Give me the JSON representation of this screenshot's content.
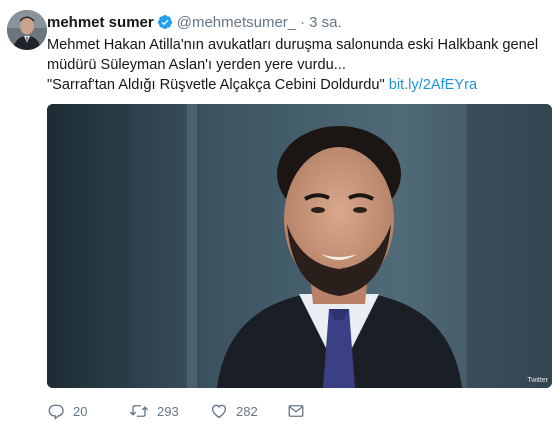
{
  "tweet": {
    "author_name": "mehmet sumer",
    "handle": "@mehmetsumer_",
    "separator": "·",
    "time": "3 sa.",
    "text_line1": "Mehmet Hakan Atilla'nın avukatları duruşma salonunda eski Halkbank genel",
    "text_line2": "müdürü Süleyman Aslan'ı yerden yere vurdu...",
    "text_line3": "\"Sarraf'tan Aldığı Rüşvetle Alçakça Cebini Doldurdu\"",
    "link": "bit.ly/2AfEYra",
    "media_watermark": "Twitter"
  },
  "actions": {
    "reply_count": "20",
    "retweet_count": "293",
    "like_count": "282"
  },
  "icons": {
    "verified": "verified-badge-icon",
    "reply": "reply-icon",
    "retweet": "retweet-icon",
    "like": "heart-icon",
    "message": "direct-message-icon"
  },
  "colors": {
    "link": "#1b95e0",
    "verified": "#1da1f2",
    "secondary_text": "#657786",
    "primary_text": "#14171a"
  }
}
